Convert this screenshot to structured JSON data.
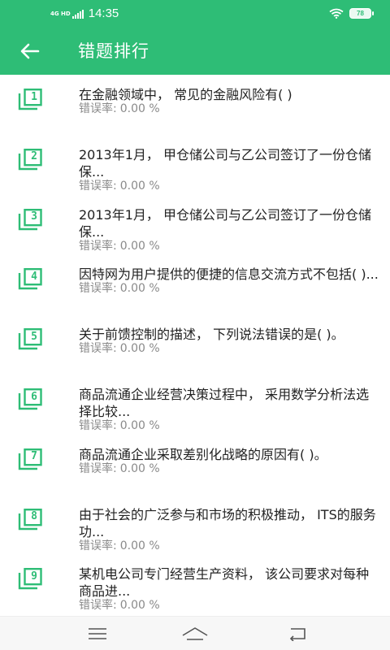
{
  "status_bar": {
    "network": "4G HD",
    "time": "14:35",
    "battery": "78"
  },
  "header": {
    "title": "错题排行",
    "back_icon": "arrow-left-icon"
  },
  "rate_label": "错误率:",
  "items": [
    {
      "rank": "1",
      "question": "在金融领域中， 常见的金融风险有(  )",
      "rate": "0.00 %"
    },
    {
      "rank": "2",
      "question": "2013年1月， 甲仓储公司与乙公司签订了一份仓储保...",
      "rate": "0.00 %"
    },
    {
      "rank": "3",
      "question": "2013年1月， 甲仓储公司与乙公司签订了一份仓储保...",
      "rate": "0.00 %"
    },
    {
      "rank": "4",
      "question": "因特网为用户提供的便捷的信息交流方式不包括(  )...",
      "rate": "0.00 %"
    },
    {
      "rank": "5",
      "question": "关于前馈控制的描述， 下列说法错误的是(  )。",
      "rate": "0.00 %"
    },
    {
      "rank": "6",
      "question": "商品流通企业经营决策过程中， 采用数学分析法选择比较...",
      "rate": "0.00 %"
    },
    {
      "rank": "7",
      "question": "商品流通企业采取差别化战略的原因有(  )。",
      "rate": "0.00 %"
    },
    {
      "rank": "8",
      "question": "由于社会的广泛参与和市场的积极推动， ITS的服务功...",
      "rate": "0.00 %"
    },
    {
      "rank": "9",
      "question": "某机电公司专门经营生产资料， 该公司要求对每种商品进...",
      "rate": "0.00 %"
    }
  ],
  "colors": {
    "primary": "#2ebd76",
    "text": "#222222",
    "secondary_text": "#8a8a8a"
  },
  "nav_bar": {
    "menu_icon": "menu-icon",
    "home_icon": "home-icon",
    "back_icon": "back-icon"
  }
}
